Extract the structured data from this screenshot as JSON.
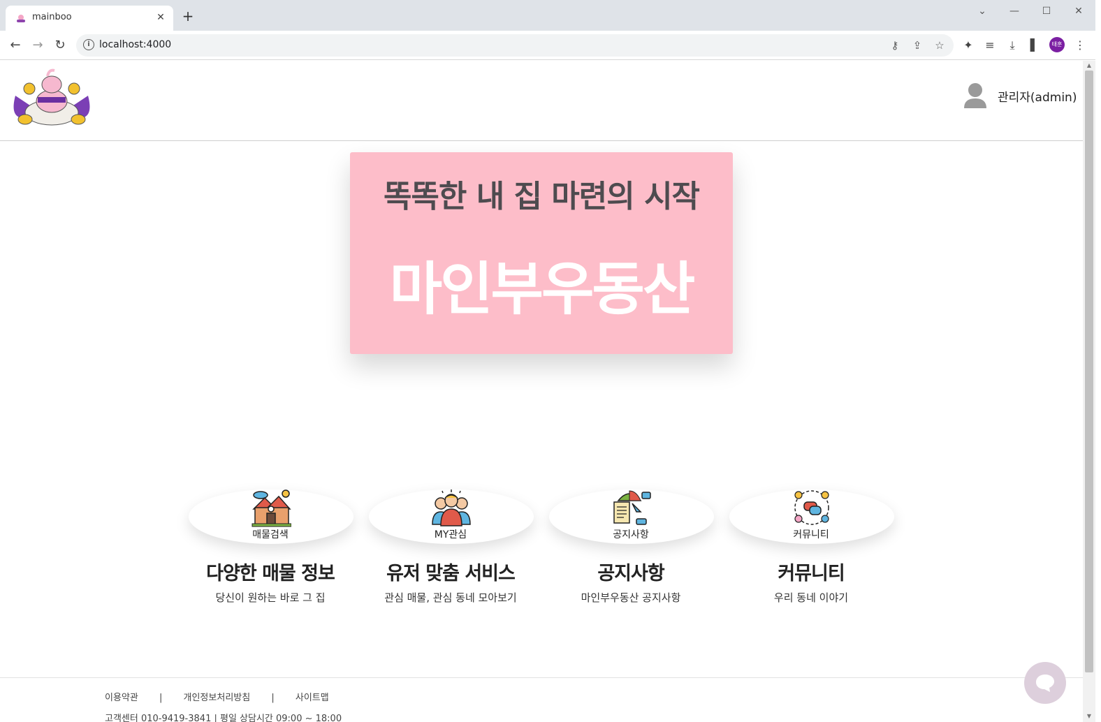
{
  "browser": {
    "tab_title": "mainboo",
    "tab_close": "✕",
    "new_tab": "+",
    "url": "localhost:4000",
    "profile_initials": "태훈",
    "icons": [
      "back-icon",
      "forward-icon",
      "reload-icon",
      "key-icon",
      "share-icon",
      "star-icon",
      "extensions-icon",
      "media-icon",
      "download-icon",
      "sidepanel-icon",
      "menu-icon"
    ]
  },
  "header": {
    "user_name": "관리자(admin)"
  },
  "hero": {
    "tagline": "똑똑한 내 집 마련의 시작",
    "brand": "마인부우동산",
    "background": "#fdbdc9"
  },
  "features": [
    {
      "icon": "house-icon",
      "icon_label": "매물검색",
      "title": "다양한 매물 정보",
      "desc": "당신이 원하는 바로 그 집"
    },
    {
      "icon": "people-icon",
      "icon_label": "MY관심",
      "title": "유저 맞춤 서비스",
      "desc": "관심 매물, 관심 동네 모아보기"
    },
    {
      "icon": "notice-icon",
      "icon_label": "공지사항",
      "title": "공지사항",
      "desc": "마인부우동산 공지사항"
    },
    {
      "icon": "community-icon",
      "icon_label": "커뮤니티",
      "title": "커뮤니티",
      "desc": "우리 동네 이야기"
    }
  ],
  "footer": {
    "links": [
      "이용약관",
      "개인정보처리방침",
      "사이트맵"
    ],
    "separator": "|",
    "info": "고객센터 010-9419-3841 | 평일 상담시간 09:00 ~ 18:00"
  }
}
